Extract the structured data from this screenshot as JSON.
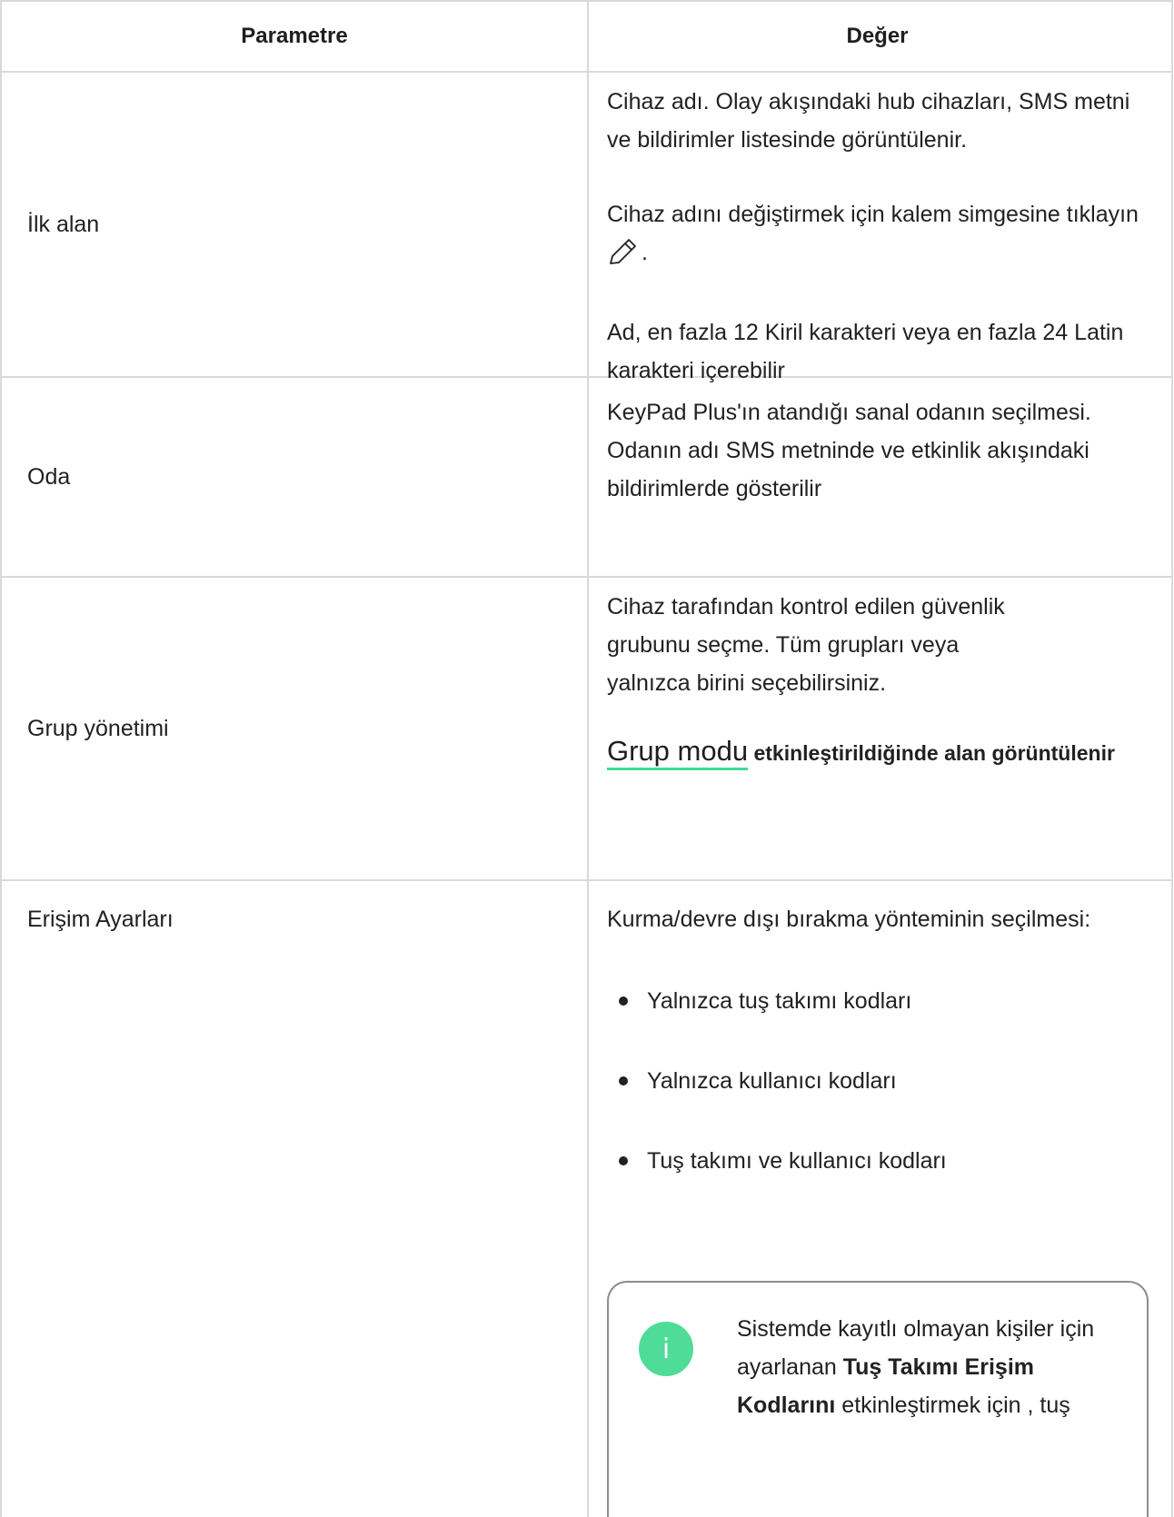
{
  "table": {
    "header": {
      "col1": "Parametre",
      "col2": "Değer"
    },
    "rows": {
      "first_field": {
        "name": "İlk alan",
        "p1": "Cihaz adı. Olay akışındaki hub cihazları, SMS metni ve bildirimler listesinde görüntülenir.",
        "p2_before": "Cihaz adını değiştirmek için kalem simgesine tıklayın",
        "p2_icon": "pencil-icon",
        "p2_after": ".",
        "p3": "Ad, en fazla 12 Kiril karakteri veya en fazla 24 Latin karakteri içerebilir"
      },
      "room": {
        "name": "Oda",
        "value": "KeyPad Plus'ın atandığı sanal odanın seçilmesi. Odanın adı SMS metninde ve etkinlik akışındaki bildirimlerde gösterilir"
      },
      "group": {
        "name": "Grup yönetimi",
        "p1": "Cihaz tarafından kontrol edilen güvenlik grubunu seçme. Tüm grupları veya yalnızca birini seçebilirsiniz.",
        "link": "Grup modu",
        "note_rest": " etkinleştirildiğinde alan görüntülenir"
      },
      "access": {
        "name": "Erişim Ayarları",
        "intro": "Kurma/devre dışı bırakma yönteminin seçilmesi:",
        "bullets": [
          "Yalnızca tuş takımı kodları",
          "Yalnızca kullanıcı kodları",
          "Tuş takımı ve kullanıcı kodları"
        ],
        "info": {
          "icon": "info-icon",
          "icon_glyph": "i",
          "icon_color": "#4fdc98",
          "text_before": "Sistemde kayıtlı olmayan kişiler için ayarlanan ",
          "text_bold": "Tuş Takımı Erişim Kodlarını",
          "text_after": " etkinleştirmek için , tuş"
        }
      }
    }
  }
}
